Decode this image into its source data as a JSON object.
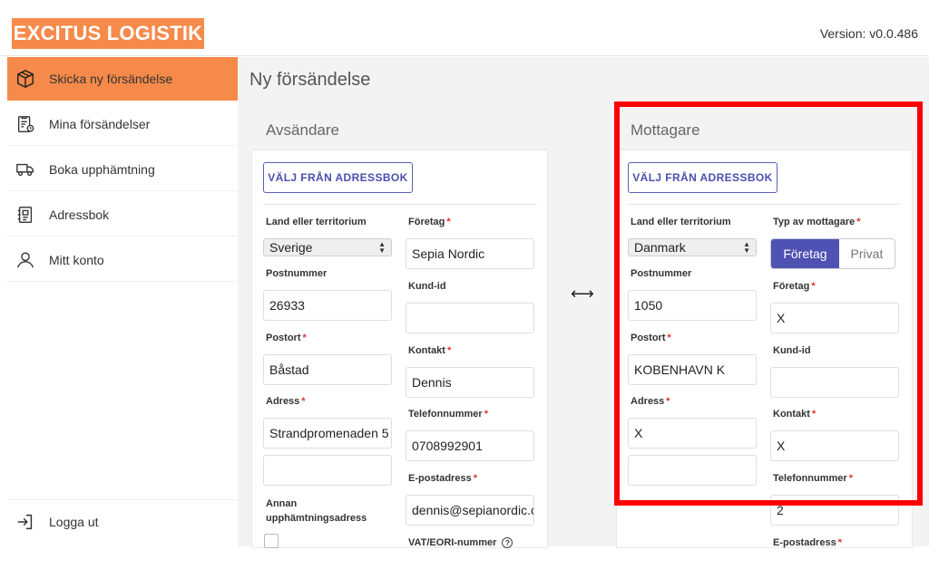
{
  "header": {
    "logo": "EXCITUS LOGISTIK",
    "version": "Version: v0.0.486"
  },
  "sidebar": {
    "items": [
      {
        "label": "Skicka ny försändelse",
        "icon": "package-icon",
        "active": true
      },
      {
        "label": "Mina försändelser",
        "icon": "clipboard-clock-icon"
      },
      {
        "label": "Boka upphämtning",
        "icon": "truck-icon"
      },
      {
        "label": "Adressbok",
        "icon": "address-book-icon"
      },
      {
        "label": "Mitt konto",
        "icon": "user-icon"
      }
    ],
    "logout": {
      "label": "Logga ut",
      "icon": "logout-icon"
    }
  },
  "page": {
    "title": "Ny försändelse",
    "swap_symbol": "⟷"
  },
  "sender": {
    "title": "Avsändare",
    "address_book_button": "VÄLJ FRÅN ADRESSBOK",
    "country_label": "Land eller territorium",
    "country_value": "Sverige",
    "postal_code_label": "Postnummer",
    "postal_code_value": "26933",
    "city_label": "Postort",
    "city_value": "Båstad",
    "address_label": "Adress",
    "address_value": "Strandpromenaden 5",
    "address2_value": "",
    "alt_pickup_label": "Annan upphämtningsadress",
    "company_label": "Företag",
    "company_value": "Sepia Nordic",
    "customer_id_label": "Kund-id",
    "customer_id_value": "",
    "contact_label": "Kontakt",
    "contact_value": "Dennis",
    "phone_label": "Telefonnummer",
    "phone_value": "0708992901",
    "email_label": "E-postadress",
    "email_value": "dennis@sepianordic.c",
    "vat_label": "VAT/EORI-nummer"
  },
  "receiver": {
    "title": "Mottagare",
    "address_book_button": "VÄLJ FRÅN ADRESSBOK",
    "country_label": "Land eller territorium",
    "country_value": "Danmark",
    "postal_code_label": "Postnummer",
    "postal_code_value": "1050",
    "city_label": "Postort",
    "city_value": "KOBENHAVN K",
    "address_label": "Adress",
    "address_value": "X",
    "address2_value": "",
    "type_label": "Typ av mottagare",
    "type_options": [
      "Företag",
      "Privat"
    ],
    "company_label": "Företag",
    "company_value": "X",
    "customer_id_label": "Kund-id",
    "customer_id_value": "",
    "contact_label": "Kontakt",
    "contact_value": "X",
    "phone_label": "Telefonnummer",
    "phone_value": "2",
    "email_label": "E-postadress"
  },
  "colors": {
    "brand": "#f68a4a",
    "accent": "#4f52b2",
    "highlight": "#ff0000",
    "required": "#d33333"
  }
}
